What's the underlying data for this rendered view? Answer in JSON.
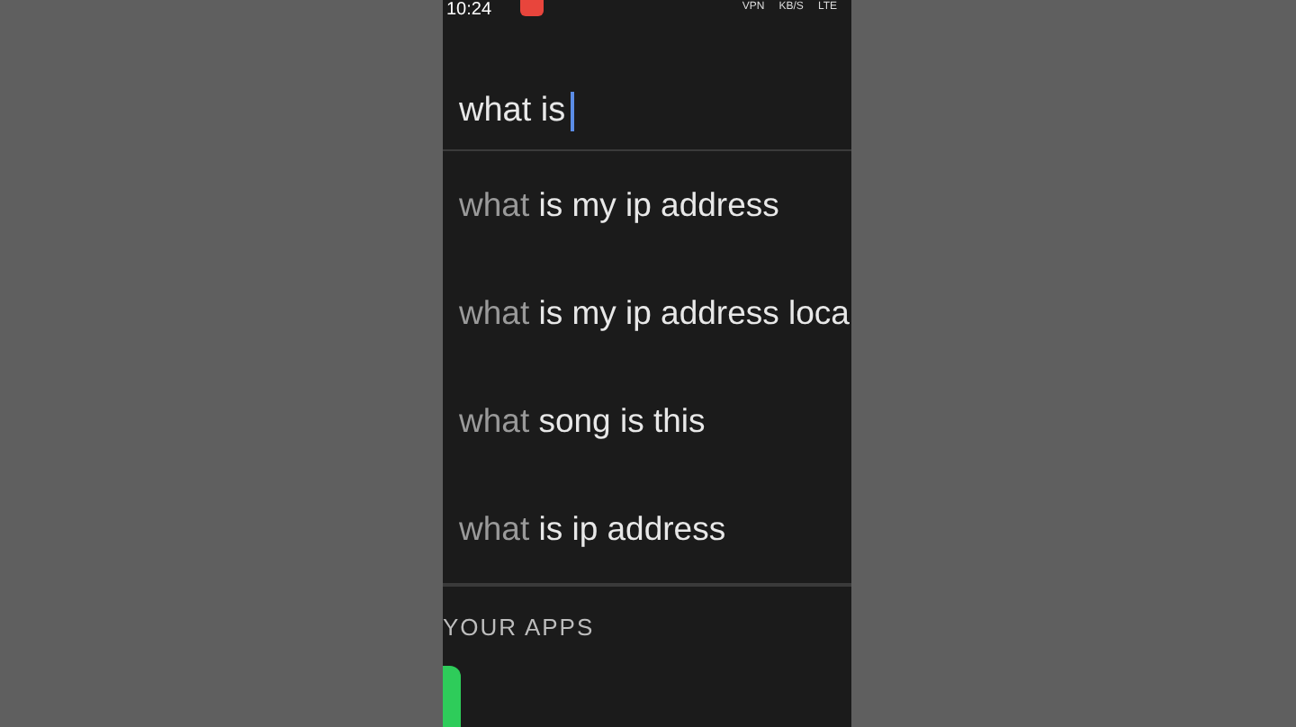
{
  "status_bar": {
    "time": "10:24",
    "indicators": [
      "VPN",
      "KB/S",
      "LTE"
    ]
  },
  "search": {
    "value": "what is"
  },
  "suggestions": [
    {
      "typed": "what",
      "completion": " is my ip address"
    },
    {
      "typed": "what",
      "completion": " is my ip address loca"
    },
    {
      "typed": "what",
      "completion": " song is this"
    },
    {
      "typed": "what",
      "completion": " is ip address"
    }
  ],
  "apps_section": {
    "title": "YOUR APPS"
  }
}
